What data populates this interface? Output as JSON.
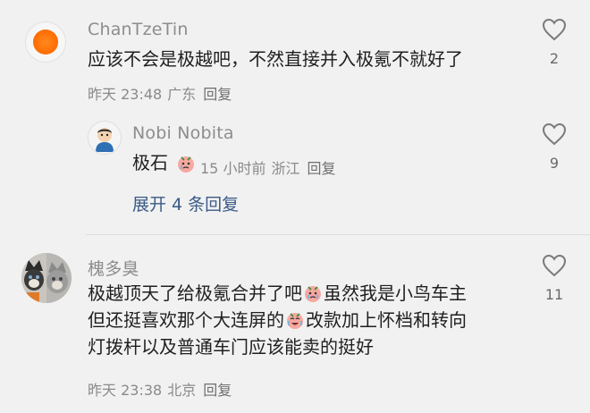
{
  "comments": [
    {
      "username": "ChanTzeTin",
      "text": "应该不会是极越吧，不然直接并入极氪不就好了",
      "time": "昨天 23:48",
      "location": "广东",
      "reply_label": "回复",
      "likes": "2",
      "replies": [
        {
          "username": "Nobi Nobita",
          "text": "极石",
          "time": "15 小时前",
          "location": "浙江",
          "reply_label": "回复",
          "likes": "9"
        }
      ],
      "expand_label": "展开 4 条回复"
    },
    {
      "username": "槐多臭",
      "text_line1_a": "极越顶天了给极氪合并了吧",
      "text_line1_b": "虽然我是小鸟车主",
      "text_line2_a": "但还挺喜欢那个大连屏的",
      "text_line2_b": "改款加上怀档和转向",
      "text_line3": "灯拨杆以及普通车门应该能卖的挺好",
      "time": "昨天 23:38",
      "location": "北京",
      "reply_label": "回复",
      "likes": "11"
    }
  ],
  "icons": {
    "like": "heart-outline-icon",
    "emoji_sad": "crying-face-emoji",
    "emoji_laugh": "laughing-tears-emoji"
  },
  "colors": {
    "background": "#f1f1f1",
    "link_blue": "#3a5a86",
    "meta_gray": "#8a8a8a"
  }
}
